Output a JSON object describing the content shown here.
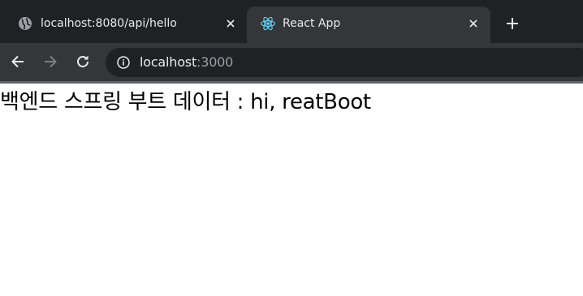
{
  "tabs": [
    {
      "title": "localhost:8080/api/hello",
      "icon": "globe-icon",
      "active": false
    },
    {
      "title": "React App",
      "icon": "react-icon",
      "active": true
    }
  ],
  "toolbar": {
    "url_host": "localhost",
    "url_port": ":3000"
  },
  "page": {
    "text": "백엔드 스프링 부트 데이터 : hi, reatBoot"
  },
  "colors": {
    "tabstrip_bg": "#202124",
    "active_tab_bg": "#35363a",
    "omnibox_bg": "#202124",
    "text_light": "#e8eaed",
    "text_muted": "#9aa0a6",
    "react_blue": "#61dafb"
  }
}
